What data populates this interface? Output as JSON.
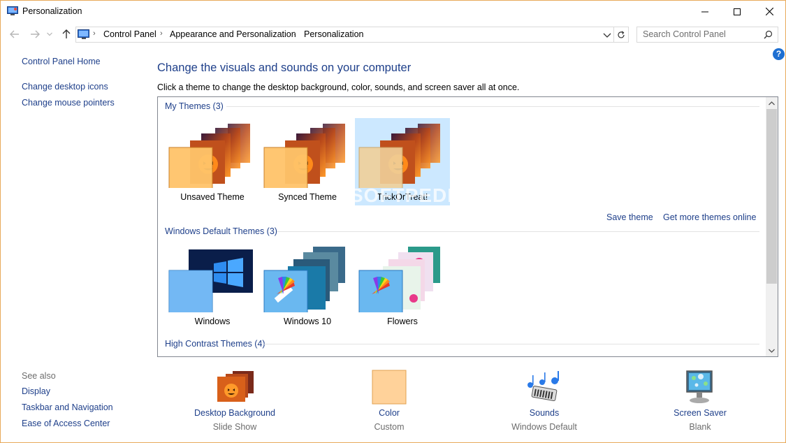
{
  "window": {
    "title": "Personalization",
    "controls": [
      "minimize",
      "maximize",
      "close"
    ]
  },
  "nav": {
    "breadcrumb": [
      "Control Panel",
      "Appearance and Personalization",
      "Personalization"
    ],
    "search_placeholder": "Search Control Panel"
  },
  "sidebar": {
    "links": [
      "Control Panel Home",
      "Change desktop icons",
      "Change mouse pointers"
    ],
    "see_also_label": "See also",
    "see_also": [
      "Display",
      "Taskbar and Navigation",
      "Ease of Access Center"
    ]
  },
  "main": {
    "title": "Change the visuals and sounds on your computer",
    "description": "Click a theme to change the desktop background, color, sounds, and screen saver all at once."
  },
  "themes": {
    "groups": [
      {
        "header": "My Themes (3)",
        "items": [
          {
            "label": "Unsaved Theme",
            "selected": false
          },
          {
            "label": "Synced Theme",
            "selected": false
          },
          {
            "label": "TrickOrTreat!",
            "selected": true
          }
        ],
        "actions": [
          "Save theme",
          "Get more themes online"
        ]
      },
      {
        "header": "Windows Default Themes (3)",
        "items": [
          {
            "label": "Windows",
            "selected": false
          },
          {
            "label": "Windows 10",
            "selected": false
          },
          {
            "label": "Flowers",
            "selected": false
          }
        ]
      },
      {
        "header": "High Contrast Themes (4)",
        "items": []
      }
    ]
  },
  "bottom": [
    {
      "label": "Desktop Background",
      "sub": "Slide Show",
      "icon": "halloween-wallpaper-icon"
    },
    {
      "label": "Color",
      "sub": "Custom",
      "icon": "color-swatch-icon"
    },
    {
      "label": "Sounds",
      "sub": "Windows Default",
      "icon": "music-notes-icon"
    },
    {
      "label": "Screen Saver",
      "sub": "Blank",
      "icon": "monitor-icon"
    }
  ],
  "watermark": "SOFTPEDIA",
  "colors": {
    "link": "#1e3f8a",
    "selected_tile": "#cce8ff",
    "window_border": "#e8a95a",
    "accent_orange": "#ffc878"
  }
}
